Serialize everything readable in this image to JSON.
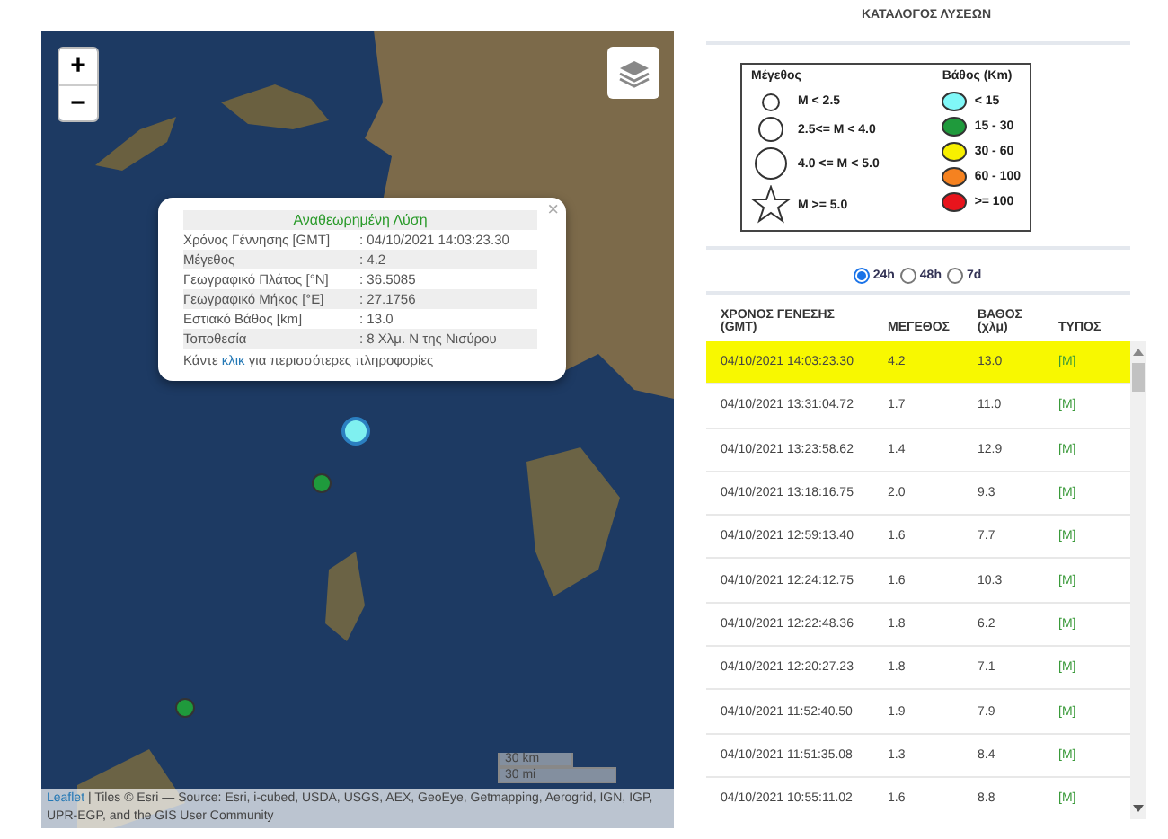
{
  "map": {
    "zoom_in": "+",
    "zoom_out": "−",
    "markers": [
      {
        "color": "#7ff0f0",
        "selected": true
      },
      {
        "color": "#1f9a3c",
        "selected": false
      },
      {
        "color": "#1f9a3c",
        "selected": false
      }
    ],
    "popup": {
      "close": "×",
      "title": "Αναθεωρημένη Λύση",
      "rows": [
        {
          "label": "Χρόνος Γέννησης [GMT]",
          "value": ": 04/10/2021 14:03:23.30"
        },
        {
          "label": "Μέγεθος",
          "value": ": 4.2"
        },
        {
          "label": "Γεωγραφικό Πλάτος [°N]",
          "value": ": 36.5085"
        },
        {
          "label": "Γεωγραφικό Μήκος [°E]",
          "value": ": 27.1756"
        },
        {
          "label": "Εστιακό Βάθος [km]",
          "value": ": 13.0"
        },
        {
          "label": "Τοποθεσία",
          "value": ": 8 Χλμ. Ν της Νισύρου"
        }
      ],
      "footer_before": "Κάντε",
      "footer_link": "κλικ",
      "footer_after": "για περισσότερες πληροφορίες"
    },
    "scale": [
      "30 km",
      "30 mi"
    ],
    "attribution_link": "Leaflet",
    "attribution_text": "| Tiles © Esri — Source: Esri, i-cubed, USDA, USGS, AEX, GeoEye, Getmapping, Aerogrid, IGN, IGP, UPR-EGP, and the GIS User Community"
  },
  "catalog": {
    "title": "ΚΑΤΑΛΟΓΟΣ ΛΥΣΕΩΝ",
    "legend": {
      "size_title": "Μέγεθος",
      "sizes": [
        {
          "kind": "small",
          "label": "M < 2.5"
        },
        {
          "kind": "medium",
          "label": "2.5<= M < 4.0"
        },
        {
          "kind": "large",
          "label": "4.0 <= M < 5.0"
        },
        {
          "kind": "star",
          "label": "M >= 5.0"
        }
      ],
      "depth_title": "Βάθος (Km)",
      "depths": [
        {
          "color": "#80f8f8",
          "label": "< 15"
        },
        {
          "color": "#1f9a3c",
          "label": "15 - 30"
        },
        {
          "color": "#f8f000",
          "label": "30 - 60"
        },
        {
          "color": "#f58220",
          "label": "60 - 100"
        },
        {
          "color": "#e8141c",
          "label": ">= 100"
        }
      ]
    },
    "periods": [
      {
        "label": "24h",
        "selected": true
      },
      {
        "label": "48h",
        "selected": false
      },
      {
        "label": "7d",
        "selected": false
      }
    ],
    "columns": [
      "ΧΡΟΝΟΣ ΓΕΝΕΣΗΣ (GMT)",
      "ΜΕΓΕΘΟΣ",
      "ΒΑΘΟΣ (χλμ)",
      "ΤΥΠΟΣ"
    ],
    "rows": [
      {
        "time": "04/10/2021 14:03:23.30",
        "mag": "4.2",
        "depth": "13.0",
        "type": "[M]",
        "selected": true
      },
      {
        "time": "04/10/2021 13:31:04.72",
        "mag": "1.7",
        "depth": "11.0",
        "type": "[M]",
        "selected": false
      },
      {
        "time": "04/10/2021 13:23:58.62",
        "mag": "1.4",
        "depth": "12.9",
        "type": "[M]",
        "selected": false
      },
      {
        "time": "04/10/2021 13:18:16.75",
        "mag": "2.0",
        "depth": "9.3",
        "type": "[M]",
        "selected": false
      },
      {
        "time": "04/10/2021 12:59:13.40",
        "mag": "1.6",
        "depth": "7.7",
        "type": "[M]",
        "selected": false
      },
      {
        "time": "04/10/2021 12:24:12.75",
        "mag": "1.6",
        "depth": "10.3",
        "type": "[M]",
        "selected": false
      },
      {
        "time": "04/10/2021 12:22:48.36",
        "mag": "1.8",
        "depth": "6.2",
        "type": "[M]",
        "selected": false
      },
      {
        "time": "04/10/2021 12:20:27.23",
        "mag": "1.8",
        "depth": "7.1",
        "type": "[M]",
        "selected": false
      },
      {
        "time": "04/10/2021 11:52:40.50",
        "mag": "1.9",
        "depth": "7.9",
        "type": "[M]",
        "selected": false
      },
      {
        "time": "04/10/2021 11:51:35.08",
        "mag": "1.3",
        "depth": "8.4",
        "type": "[M]",
        "selected": false
      },
      {
        "time": "04/10/2021 10:55:11.02",
        "mag": "1.6",
        "depth": "8.8",
        "type": "[M]",
        "selected": false
      }
    ]
  }
}
